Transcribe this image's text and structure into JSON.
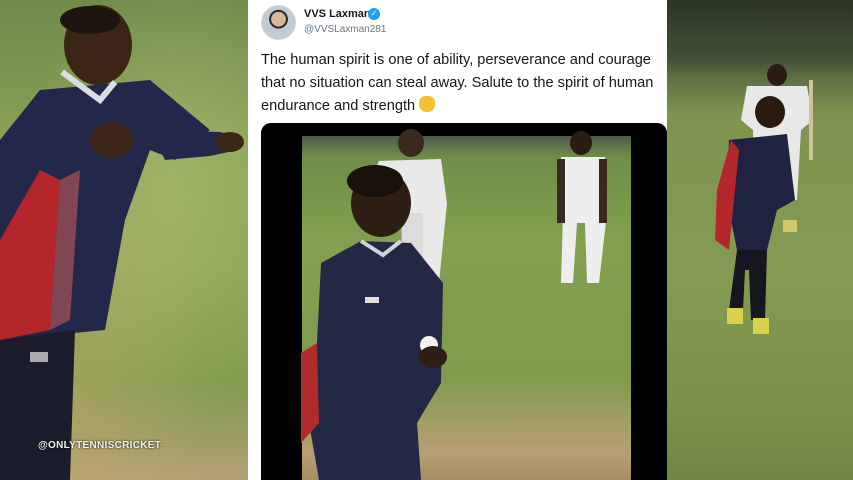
{
  "watermark": "@ONLYTENNISCRICKET",
  "tweet": {
    "display_name": "VVS Laxman",
    "handle": "@VVSLaxman281",
    "text": "The human spirit is one of ability, perseverance and courage that no situation can steal away. Salute to the spirit of human endurance and strength",
    "emoji": "folded-hands"
  },
  "colors": {
    "verified_badge": "#1da1f2",
    "text_primary": "#14171a",
    "text_secondary": "#657786"
  }
}
